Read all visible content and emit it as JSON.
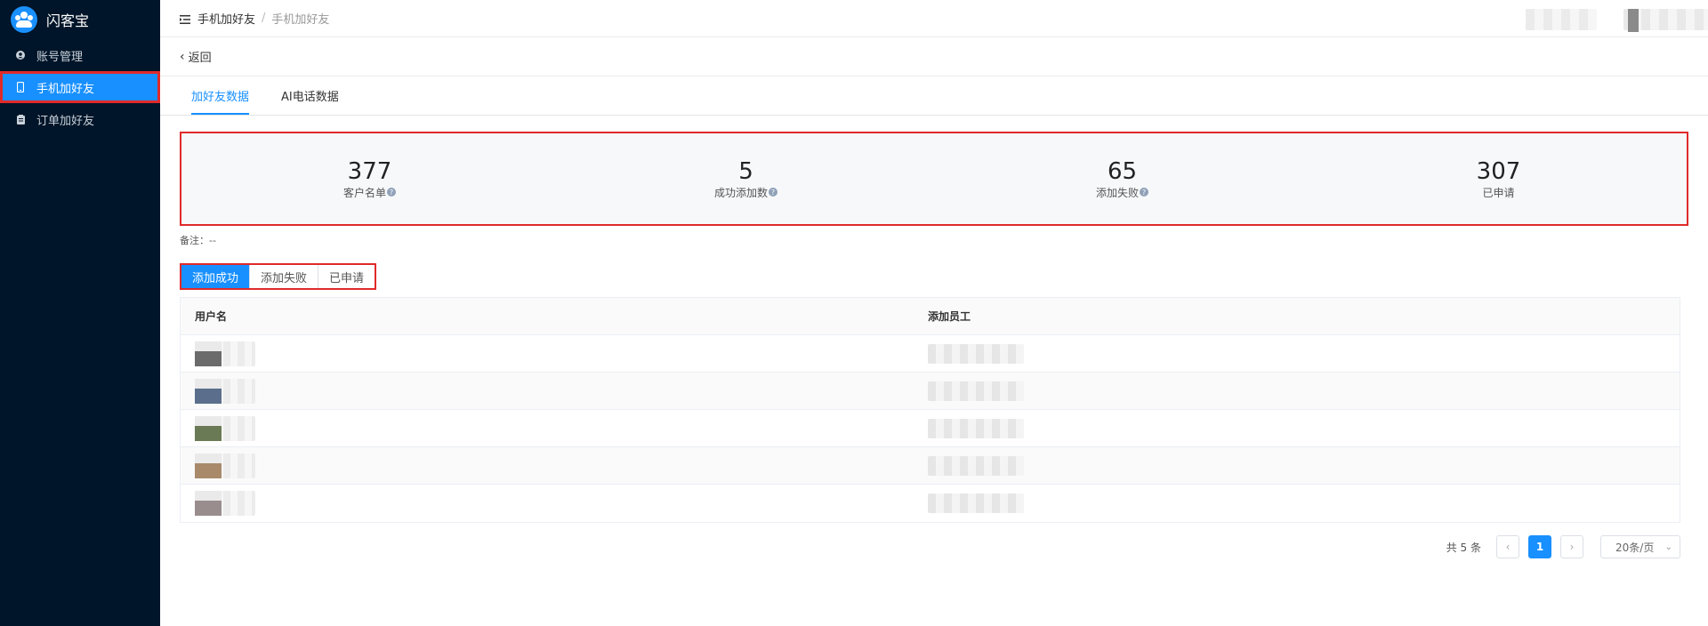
{
  "app": {
    "name": "闪客宝"
  },
  "sidebar": {
    "items": [
      {
        "label": "账号管理",
        "icon": "user-circle-icon"
      },
      {
        "label": "手机加好友",
        "icon": "phone-icon"
      },
      {
        "label": "订单加好友",
        "icon": "clipboard-icon"
      }
    ],
    "active_index": 1
  },
  "breadcrumb": {
    "items": [
      "手机加好友",
      "手机加好友"
    ],
    "separator": "/"
  },
  "back": {
    "label": "返回"
  },
  "tabs": [
    {
      "label": "加好友数据"
    },
    {
      "label": "AI电话数据"
    }
  ],
  "stats": [
    {
      "value": "377",
      "label": "客户名单"
    },
    {
      "value": "5",
      "label": "成功添加数"
    },
    {
      "value": "65",
      "label": "添加失败"
    },
    {
      "value": "307",
      "label": "已申请"
    }
  ],
  "note": "备注：--",
  "filters": [
    {
      "label": "添加成功"
    },
    {
      "label": "添加失败"
    },
    {
      "label": "已申请"
    }
  ],
  "table": {
    "columns": [
      "用户名",
      "添加员工"
    ],
    "row_count": 5
  },
  "pagination": {
    "total_label": "共 5 条",
    "current_page": "1",
    "prev_icon": "chevron-left-icon",
    "next_icon": "chevron-right-icon",
    "page_size": "20条/页"
  },
  "colors": {
    "sidebar_bg": "#001529",
    "accent": "#1890ff",
    "highlight": "#e02a2a"
  }
}
